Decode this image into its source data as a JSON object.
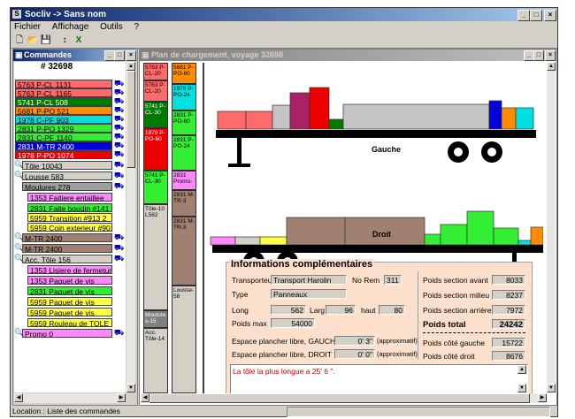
{
  "app": {
    "title": "Socliv -> Sans nom"
  },
  "menu": [
    "Fichier",
    "Affichage",
    "Outils",
    "?"
  ],
  "commandes": {
    "title": "Commandes",
    "header": "# 32698",
    "items": [
      {
        "label": "5763 P-CL 1131",
        "color": "#ff6a6a"
      },
      {
        "label": "5763 P-CL 1165",
        "color": "#ff6a6a"
      },
      {
        "label": "5741 P-CL 508",
        "color": "#007a00"
      },
      {
        "label": "5681 P-PO 521",
        "color": "#ff8c00"
      },
      {
        "label": "1978 C-PF 903",
        "color": "#00e0e0"
      },
      {
        "label": "2831 P-PO 1329",
        "color": "#33ee33"
      },
      {
        "label": "2831 C-PF 1140",
        "color": "#33ee33"
      },
      {
        "label": "2831 M-TR 2400",
        "color": "#0000dd"
      },
      {
        "label": "1978 P-PO 1074",
        "color": "#ee0000"
      },
      {
        "label": "Tôle 10043",
        "color": "#d4d0c8"
      },
      {
        "label": "Lousse 583",
        "color": "#d4d0c8"
      },
      {
        "label": "Moulures 278",
        "color": "#a0a0a0"
      },
      {
        "label": "1353 Faitiere entaillee",
        "color": "#ff88ff"
      },
      {
        "label": "2831 Faite boudin #141 7",
        "color": "#33ee33"
      },
      {
        "label": "5959 Transition #913 2",
        "color": "#ffff44"
      },
      {
        "label": "5959 Coin exterieur #901",
        "color": "#ffff44"
      },
      {
        "label": "M-TR 2400",
        "color": "#a08070"
      },
      {
        "label": "M-TR 2400",
        "color": "#a08070"
      },
      {
        "label": "Acc. Tôle 156",
        "color": "#d4d0c8"
      },
      {
        "label": "1353 Lisiere de fermeture",
        "color": "#ff88ff"
      },
      {
        "label": "1353 Paquet de vis",
        "color": "#ff88ff"
      },
      {
        "label": "2831 Paquet de vis",
        "color": "#33ee33"
      },
      {
        "label": "5959 Paquet de vis",
        "color": "#ffff44"
      },
      {
        "label": "5959 Paquet de vis",
        "color": "#ffff44"
      },
      {
        "label": "5959 Rouleau de TOLE",
        "color": "#ffff44"
      },
      {
        "label": "Promo 0",
        "color": "#ff88ff"
      }
    ]
  },
  "plan": {
    "title": "Plan de chargement, voyage 32698",
    "col1": [
      {
        "label": "5763 P-CL-20",
        "color": "#ff6a6a"
      },
      {
        "label": "5763 P-CL-20",
        "color": "#ff6a6a"
      },
      {
        "label": "5741 P-CL-30",
        "color": "#007a00"
      },
      {
        "label": "1978 P-PO-60",
        "color": "#ee0000"
      },
      {
        "label": "5741 P-CL-30",
        "color": "#33ee33"
      },
      {
        "label": "Tôle-10 L562",
        "color": "#d4d0c8"
      },
      {
        "label": "Moulure s-15",
        "color": "#808080"
      },
      {
        "label": "Acc. Tôle-14",
        "color": "#d4d0c8"
      }
    ],
    "col2": [
      {
        "label": "5681 P-PO-60",
        "color": "#ff8c00"
      },
      {
        "label": "1978 P-PO-24",
        "color": "#00e0e0"
      },
      {
        "label": "2831 P-PO-60",
        "color": "#33ee33"
      },
      {
        "label": "2831 P-PO-24",
        "color": "#33ee33"
      },
      {
        "label": "2831 Promo-",
        "color": "#ff88ff"
      },
      {
        "label": "2831 M-TR-3",
        "color": "#a08070"
      },
      {
        "label": "2831 M-TR-3",
        "color": "#a08070"
      },
      {
        "label": "Lousse-58",
        "color": "#d4d0c8"
      }
    ],
    "side_gauche": "Gauche",
    "side_droit": "Droit"
  },
  "info": {
    "title": "Informations complémentaires",
    "transporteur_label": "Transporteur",
    "transporteur": "Transport Harolin",
    "norem_label": "No Rem",
    "norem": "311",
    "type_label": "Type",
    "type": "Panneaux",
    "long_label": "Long",
    "long": "562",
    "larg_label": "Larg",
    "larg": "96",
    "haut_label": "haut",
    "haut": "80",
    "poidsmax_label": "Poids max",
    "poidsmax": "54000",
    "espace_g_label": "Espace plancher libre, GAUCHE",
    "espace_g": "0' 3\"",
    "espace_d_label": "Espace plancher libre, DROIT",
    "espace_d": "0' 0\"",
    "approx": "(approximatif)",
    "ps_avant_label": "Poids section avant",
    "ps_avant": "8033",
    "ps_milieu_label": "Poids section milieu",
    "ps_milieu": "8237",
    "ps_arriere_label": "Poids section arrière",
    "ps_arriere": "7972",
    "ptotal_label": "Poids total",
    "ptotal": "24242",
    "pc_gauche_label": "Poids côté gauche",
    "pc_gauche": "15722",
    "pc_droit_label": "Poids côté droit",
    "pc_droit": "8676",
    "note": "La tôle la plus longue a 25' 6 \"."
  },
  "status": {
    "location": "Location : Liste des commandes"
  }
}
